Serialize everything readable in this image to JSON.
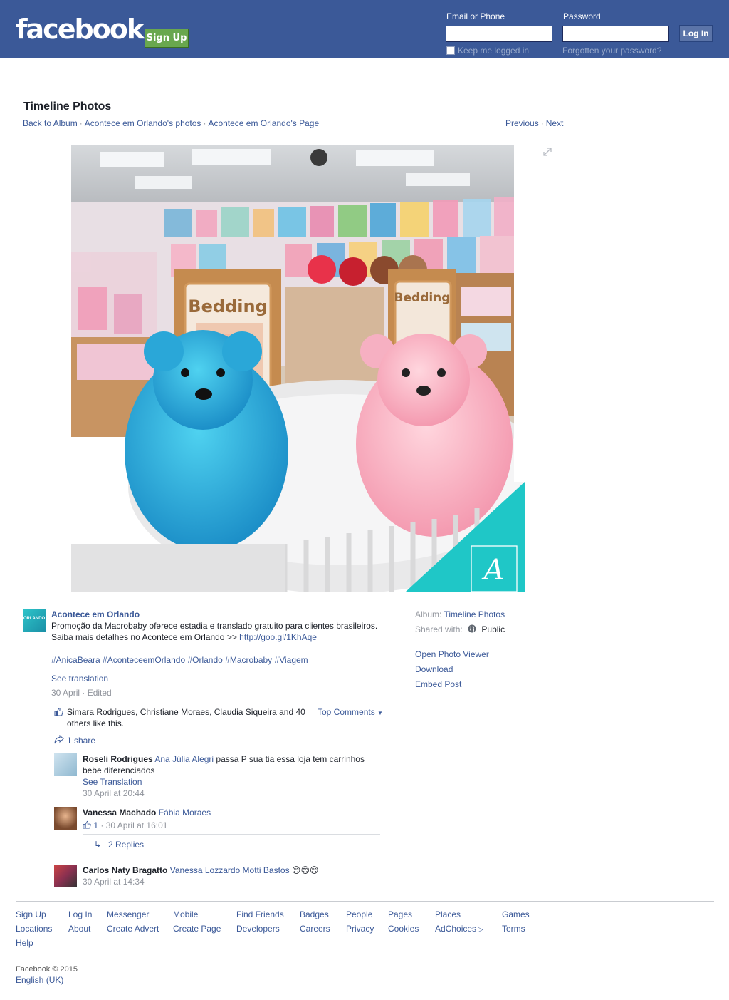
{
  "header": {
    "logo": "facebook",
    "signup_label": "Sign Up",
    "email_label": "Email or Phone",
    "password_label": "Password",
    "login_label": "Log In",
    "keep_logged_in": "Keep me logged in",
    "forgot_password": "Forgotten your password?",
    "brand_color": "#3b5998"
  },
  "album": {
    "title": "Timeline Photos",
    "back": "Back to Album",
    "photos_link": "Acontece em Orlando's photos",
    "page_link": "Acontece em Orlando's Page",
    "previous": "Previous",
    "next": "Next"
  },
  "photo": {
    "sign_left": "Bedding",
    "sign_right": "Bedding",
    "watermark_letter": "A",
    "accent_color": "#1fc7c7"
  },
  "post": {
    "avatar_text": "ORLANDO",
    "author": "Acontece em Orlando",
    "text_line1": "Promoção da Macrobaby oferece estadia e translado gratuito para clientes brasileiros.",
    "text_line2": "Saiba mais detalhes no Acontece em Orlando >> ",
    "link": "http://goo.gl/1KhAqe",
    "hashtags": "#AnicaBeara #AconteceemOrlando #Orlando #Macrobaby #Viagem",
    "see_translation": "See translation",
    "date": "30 April",
    "edited": "Edited",
    "likes_text": "Simara Rodrigues, Christiane Moraes, Claudia Siqueira and 40 others like this.",
    "top_comments": "Top Comments",
    "shares": "1 share"
  },
  "comments": [
    {
      "name": "Roseli Rodrigues",
      "tag": "Ana Júlia Alegri",
      "text": " passa P sua tia essa loja tem carrinhos bebe diferenciados",
      "see_translation": "See Translation",
      "time": "30 April at 20:44"
    },
    {
      "name": "Vanessa Machado",
      "tag": "Fábia Moraes",
      "text": "",
      "likes": "1",
      "time": "30 April at 16:01",
      "replies": "2 Replies"
    },
    {
      "name": "Carlos Naty Bragatto",
      "tag": "Vanessa Lozzardo Motti Bastos",
      "text": " 😊😊😊",
      "time": "30 April at 14:34"
    }
  ],
  "side": {
    "album_label": "Album:",
    "album_value": "Timeline Photos",
    "shared_label": "Shared with:",
    "shared_value": "Public",
    "open_viewer": "Open Photo Viewer",
    "download": "Download",
    "embed": "Embed Post"
  },
  "footer": {
    "links": [
      "Sign Up",
      "Log In",
      "Messenger",
      "Mobile",
      "Find Friends",
      "Badges",
      "People",
      "Pages",
      "Places",
      "Games",
      "Locations",
      "About",
      "Create Advert",
      "Create Page",
      "Developers",
      "Careers",
      "Privacy",
      "Cookies",
      "AdChoices",
      "Terms",
      "Help"
    ],
    "copyright": "Facebook © 2015",
    "language": "English (UK)"
  }
}
